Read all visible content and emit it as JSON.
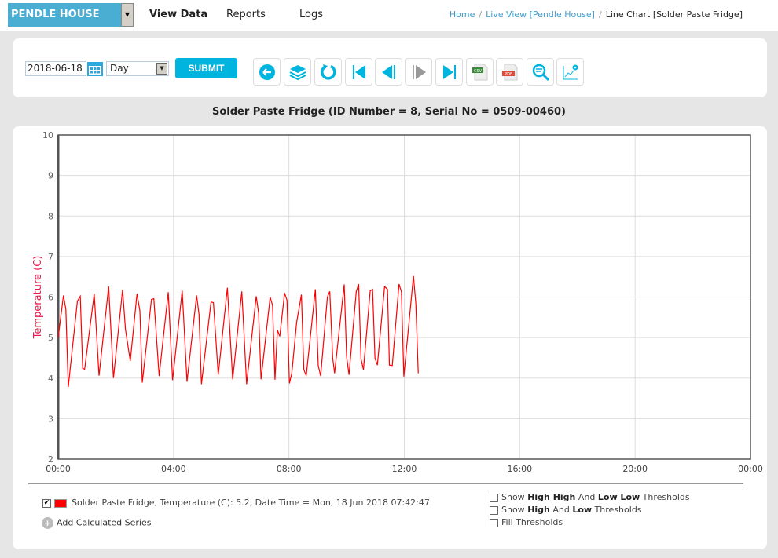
{
  "header": {
    "site": "PENDLE HOUSE",
    "nav": [
      "View Data",
      "Reports",
      "Logs"
    ],
    "breadcrumb": [
      "Home",
      "Live View [Pendle House]",
      "Line Chart [Solder Paste Fridge]"
    ]
  },
  "toolbar": {
    "date": "2018-06-18",
    "period": "Day",
    "submit": "SUBMIT",
    "icons": [
      "back-icon",
      "layers-icon",
      "refresh-icon",
      "first-icon",
      "previous-icon",
      "next-icon",
      "last-icon",
      "csv-icon",
      "pdf-icon",
      "zoom-icon",
      "chart-settings-icon"
    ],
    "csv": "CSV",
    "pdf": "PDF"
  },
  "legend": {
    "series": "Solder Paste Fridge, Temperature (C): 5.2, Date Time = Mon, 18 Jun 2018 07:42:47",
    "add": "Add Calculated Series",
    "thresholds": [
      [
        [
          "Show ",
          false
        ],
        [
          "High High",
          true
        ],
        [
          " And ",
          false
        ],
        [
          "Low Low",
          true
        ],
        [
          " Thresholds",
          false
        ]
      ],
      [
        [
          "Show ",
          false
        ],
        [
          "High",
          true
        ],
        [
          " And ",
          false
        ],
        [
          "Low",
          true
        ],
        [
          " Thresholds",
          false
        ]
      ],
      [
        [
          "Fill Thresholds",
          false
        ]
      ]
    ]
  },
  "colors": {
    "series": "#ff0000",
    "accent": "#00b4e0",
    "site": "#4aaed3"
  },
  "chart_data": {
    "type": "line",
    "title": "Solder Paste Fridge (ID Number = 8, Serial No = 0509-00460)",
    "ylabel": "Temperature (C)",
    "xlabel": "",
    "ylim": [
      2,
      10
    ],
    "xlim": [
      "00:00",
      "24:00"
    ],
    "yticks": [
      "2",
      "3",
      "4",
      "5",
      "6",
      "7",
      "8",
      "9",
      "10"
    ],
    "xticks": [
      "00:00",
      "04:00",
      "08:00",
      "12:00",
      "16:00",
      "20:00",
      "00:00"
    ],
    "grid": true,
    "series": [
      {
        "name": "Solder Paste Fridge, Temperature (C)",
        "color": "#ff0000",
        "x": [
          "00:00",
          "00:11",
          "00:16",
          "00:21",
          "00:40",
          "00:46",
          "00:51",
          "00:55",
          "01:15",
          "01:25",
          "01:45",
          "01:55",
          "02:14",
          "02:20",
          "02:30",
          "02:44",
          "02:50",
          "02:55",
          "03:14",
          "03:19",
          "03:30",
          "03:49",
          "03:58",
          "04:18",
          "04:28",
          "04:48",
          "04:53",
          "04:58",
          "05:18",
          "05:23",
          "05:33",
          "05:52",
          "06:03",
          "06:22",
          "06:32",
          "06:52",
          "06:57",
          "07:02",
          "07:21",
          "07:26",
          "07:31",
          "07:36",
          "07:41",
          "07:51",
          "07:56",
          "08:01",
          "08:06",
          "08:16",
          "08:26",
          "08:31",
          "08:36",
          "08:55",
          "09:01",
          "09:06",
          "09:20",
          "09:25",
          "09:31",
          "09:35",
          "09:55",
          "10:00",
          "10:05",
          "10:20",
          "10:25",
          "10:30",
          "10:35",
          "10:49",
          "10:54",
          "10:59",
          "11:04",
          "11:19",
          "11:25",
          "11:29",
          "11:35",
          "11:49",
          "11:54",
          "11:59",
          "12:19",
          "12:24",
          "12:29"
        ],
        "y": [
          5.0,
          6.04,
          5.7,
          3.78,
          5.9,
          6.02,
          4.24,
          4.22,
          6.08,
          4.06,
          6.26,
          4.0,
          6.18,
          5.2,
          4.42,
          6.08,
          5.66,
          3.89,
          5.94,
          5.96,
          4.05,
          6.12,
          3.95,
          6.16,
          3.91,
          6.04,
          5.57,
          3.85,
          5.88,
          5.86,
          4.08,
          6.23,
          3.97,
          6.14,
          3.85,
          6.02,
          5.6,
          3.97,
          6.0,
          5.79,
          3.96,
          5.19,
          5.03,
          6.1,
          5.92,
          3.87,
          4.12,
          5.37,
          6.06,
          4.21,
          4.06,
          6.19,
          4.31,
          4.05,
          6.0,
          6.14,
          4.5,
          4.12,
          6.31,
          4.53,
          4.08,
          6.13,
          6.32,
          4.47,
          4.21,
          6.15,
          6.19,
          4.49,
          4.32,
          6.26,
          6.19,
          4.32,
          4.31,
          6.32,
          6.13,
          4.04,
          6.52,
          5.83,
          4.12
        ]
      }
    ]
  }
}
